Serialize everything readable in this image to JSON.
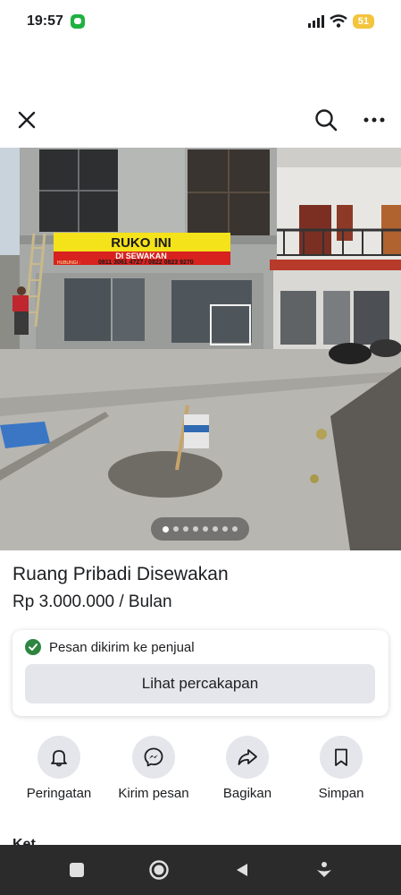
{
  "status_bar": {
    "time": "19:57",
    "battery": "51"
  },
  "top_nav": {
    "close_icon": "close-icon",
    "search_icon": "search-icon",
    "more_icon": "more-icon"
  },
  "photo": {
    "banner_title": "RUKO INI",
    "banner_subtitle": "DI SEWAKAN",
    "banner_contact_prefix": "HUBUNGI :",
    "banner_contact": "0811 3061 4727 / 0822 0823 9270",
    "dot_count": 8,
    "active_dot": 0
  },
  "listing": {
    "title": "Ruang Pribadi Disewakan",
    "price": "Rp 3.000.000 / Bulan"
  },
  "message_card": {
    "status_text": "Pesan dikirim ke penjual",
    "button_label": "Lihat percakapan"
  },
  "actions": [
    {
      "label": "Peringatan",
      "icon": "bell-icon"
    },
    {
      "label": "Kirim pesan",
      "icon": "messenger-icon"
    },
    {
      "label": "Bagikan",
      "icon": "share-icon"
    },
    {
      "label": "Simpan",
      "icon": "bookmark-icon"
    }
  ],
  "next_section_label": "Ket",
  "colors": {
    "accent_green": "#2e8540",
    "button_gray": "#e4e6eb",
    "nav_bar": "#2b2b2b",
    "banner_yellow": "#f4e21a",
    "banner_red": "#d7221f"
  }
}
